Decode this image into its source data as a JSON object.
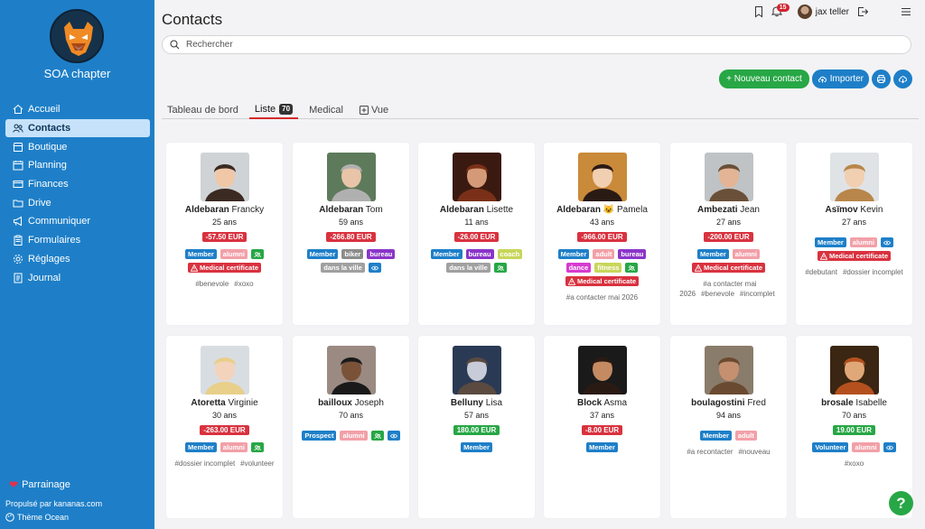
{
  "sidebar": {
    "org_name": "SOA chapter",
    "items": [
      {
        "label": "Accueil",
        "icon": "home-icon",
        "active": false
      },
      {
        "label": "Contacts",
        "icon": "users-icon",
        "active": true
      },
      {
        "label": "Boutique",
        "icon": "shop-icon",
        "active": false
      },
      {
        "label": "Planning",
        "icon": "calendar-icon",
        "active": false
      },
      {
        "label": "Finances",
        "icon": "card-icon",
        "active": false
      },
      {
        "label": "Drive",
        "icon": "folder-icon",
        "active": false
      },
      {
        "label": "Communiquer",
        "icon": "megaphone-icon",
        "active": false
      },
      {
        "label": "Formulaires",
        "icon": "clipboard-icon",
        "active": false
      },
      {
        "label": "Réglages",
        "icon": "gear-icon",
        "active": false
      },
      {
        "label": "Journal",
        "icon": "journal-icon",
        "active": false
      }
    ],
    "parrainage": "Parrainage",
    "powered_by": "Propulsé par kananas.com",
    "theme": "Thème Ocean"
  },
  "header": {
    "title": "Contacts",
    "notification_count": "15",
    "user_name": "jax teller"
  },
  "search": {
    "placeholder": "Rechercher"
  },
  "actions": {
    "new_contact": "+ Nouveau contact",
    "import": "Importer"
  },
  "tabs": [
    {
      "label": "Tableau de bord"
    },
    {
      "label": "Liste",
      "count": "70"
    },
    {
      "label": "Medical"
    },
    {
      "label": "Vue"
    }
  ],
  "colors": {
    "sidebar": "#1e7fc8",
    "member": "#1e7fc8",
    "alumni": "#f2a0a8",
    "biker": "#8c8c8c",
    "bureau": "#8a35c9",
    "coach": "#c8d65a",
    "adult": "#f2a0a8",
    "dance": "#d63bd0",
    "fitness": "#c8d65a",
    "medical": "#d9323f",
    "green": "#27a745",
    "prospect": "#1e7fc8",
    "volunteer": "#1e7fc8",
    "grey": "#a0a0a0"
  },
  "contacts": [
    {
      "last": "Aldebaran",
      "first": "Francky",
      "age": "25 ans",
      "amount": "-57.50 EUR",
      "amount_sign": "neg",
      "tags": [
        {
          "t": "Member",
          "c": "member"
        },
        {
          "t": "alumni",
          "c": "alumni"
        },
        {
          "t": "",
          "c": "green",
          "icon": "group-icon"
        },
        {
          "t": "Medical certificate",
          "c": "medical",
          "icon": "warning-icon"
        }
      ],
      "hashtags": [
        "#benevole",
        "#xoxo"
      ]
    },
    {
      "last": "Aldebaran",
      "first": "Tom",
      "age": "59 ans",
      "amount": "-266.80 EUR",
      "amount_sign": "neg",
      "tags": [
        {
          "t": "Member",
          "c": "member"
        },
        {
          "t": "biker",
          "c": "biker"
        },
        {
          "t": "bureau",
          "c": "bureau"
        },
        {
          "t": "dans la ville",
          "c": "grey"
        },
        {
          "t": "",
          "c": "member",
          "icon": "eye-icon"
        }
      ],
      "hashtags": []
    },
    {
      "last": "Aldebaran",
      "first": "Lisette",
      "age": "11 ans",
      "amount": "-26.00 EUR",
      "amount_sign": "neg",
      "tags": [
        {
          "t": "Member",
          "c": "member"
        },
        {
          "t": "bureau",
          "c": "bureau"
        },
        {
          "t": "coach",
          "c": "coach"
        },
        {
          "t": "dans la ville",
          "c": "grey"
        },
        {
          "t": "",
          "c": "green",
          "icon": "group-icon"
        }
      ],
      "hashtags": []
    },
    {
      "last": "Aldebaran",
      "first": "😺 Pamela",
      "age": "43 ans",
      "amount": "-966.00 EUR",
      "amount_sign": "neg",
      "tags": [
        {
          "t": "Member",
          "c": "member"
        },
        {
          "t": "adult",
          "c": "adult"
        },
        {
          "t": "bureau",
          "c": "bureau"
        },
        {
          "t": "dance",
          "c": "dance"
        },
        {
          "t": "fitness",
          "c": "fitness"
        },
        {
          "t": "",
          "c": "green",
          "icon": "group-icon"
        },
        {
          "t": "Medical certificate",
          "c": "medical",
          "icon": "warning-icon"
        }
      ],
      "hashtags": [
        "#a contacter mai 2026"
      ]
    },
    {
      "last": "Ambezati",
      "first": "Jean",
      "age": "27 ans",
      "amount": "-200.00 EUR",
      "amount_sign": "neg",
      "tags": [
        {
          "t": "Member",
          "c": "member"
        },
        {
          "t": "alumni",
          "c": "alumni"
        },
        {
          "t": "Medical certificate",
          "c": "medical",
          "icon": "warning-icon"
        }
      ],
      "hashtags": [
        "#a contacter mai 2026",
        "#benevole",
        "#incomplet"
      ]
    },
    {
      "last": "Asïmov",
      "first": "Kevin",
      "age": "27 ans",
      "amount": "",
      "amount_sign": "",
      "tags": [
        {
          "t": "Member",
          "c": "member"
        },
        {
          "t": "alumni",
          "c": "alumni"
        },
        {
          "t": "",
          "c": "member",
          "icon": "eye-icon"
        },
        {
          "t": "Medical certificate",
          "c": "medical",
          "icon": "warning-icon"
        }
      ],
      "hashtags": [
        "#debutant",
        "#dossier incomplet"
      ]
    },
    {
      "last": "Atoretta",
      "first": "Virginie",
      "age": "30 ans",
      "amount": "-263.00 EUR",
      "amount_sign": "neg",
      "tags": [
        {
          "t": "Member",
          "c": "member"
        },
        {
          "t": "alumni",
          "c": "alumni"
        },
        {
          "t": "",
          "c": "green",
          "icon": "group-icon"
        }
      ],
      "hashtags": [
        "#dossier incomplet",
        "#volunteer"
      ]
    },
    {
      "last": "bailloux",
      "first": "Joseph",
      "age": "70 ans",
      "amount": "",
      "amount_sign": "",
      "tags": [
        {
          "t": "Prospect",
          "c": "prospect"
        },
        {
          "t": "alumni",
          "c": "alumni"
        },
        {
          "t": "",
          "c": "green",
          "icon": "group-icon"
        },
        {
          "t": "",
          "c": "member",
          "icon": "eye-icon"
        }
      ],
      "hashtags": []
    },
    {
      "last": "Belluny",
      "first": "Lisa",
      "age": "57 ans",
      "amount": "180.00 EUR",
      "amount_sign": "pos",
      "tags": [
        {
          "t": "Member",
          "c": "member"
        }
      ],
      "hashtags": []
    },
    {
      "last": "Block",
      "first": "Asma",
      "age": "37 ans",
      "amount": "-8.00 EUR",
      "amount_sign": "neg",
      "tags": [
        {
          "t": "Member",
          "c": "member"
        }
      ],
      "hashtags": []
    },
    {
      "last": "boulagostini",
      "first": "Fred",
      "age": "94 ans",
      "amount": "",
      "amount_sign": "",
      "tags": [
        {
          "t": "Member",
          "c": "member"
        },
        {
          "t": "adult",
          "c": "adult"
        }
      ],
      "hashtags": [
        "#a recontacter",
        "#nouveau"
      ]
    },
    {
      "last": "brosale",
      "first": "Isabelle",
      "age": "70 ans",
      "amount": "19.00 EUR",
      "amount_sign": "pos",
      "tags": [
        {
          "t": "Volunteer",
          "c": "volunteer"
        },
        {
          "t": "alumni",
          "c": "alumni"
        },
        {
          "t": "",
          "c": "member",
          "icon": "eye-icon"
        }
      ],
      "hashtags": [
        "#xoxo"
      ]
    }
  ]
}
